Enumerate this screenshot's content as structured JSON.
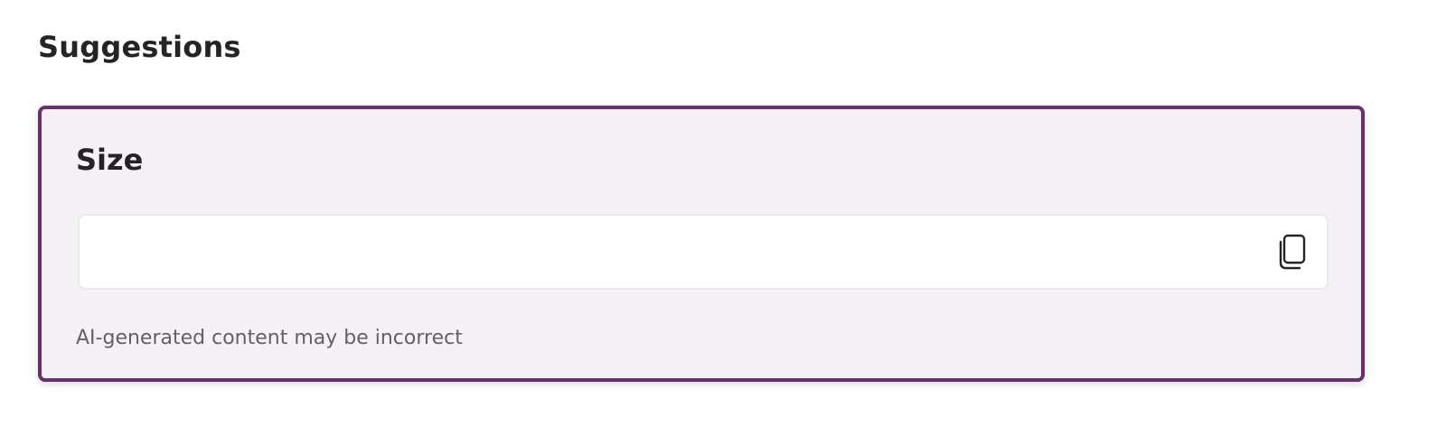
{
  "suggestions": {
    "heading": "Suggestions",
    "card": {
      "title": "Size",
      "value": "",
      "copy_icon": "copy-icon",
      "disclaimer": "AI-generated content may be incorrect"
    }
  },
  "colors": {
    "accent_border": "#6b2e72",
    "card_background": "#f6f1f7",
    "text_primary": "#242424",
    "text_secondary": "#616161"
  }
}
